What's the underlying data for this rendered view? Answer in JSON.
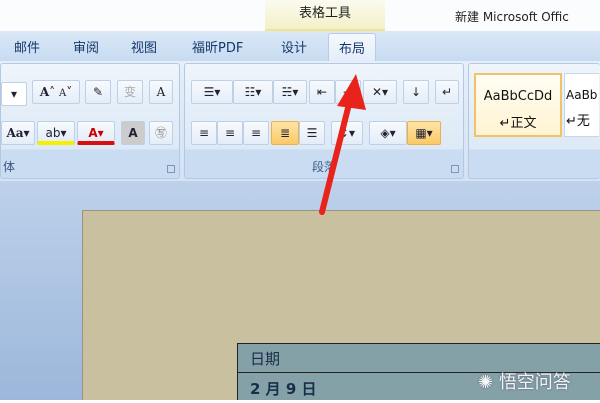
{
  "title_bar": {
    "contextual_group": "表格工具",
    "window_title": "新建 Microsoft Offic"
  },
  "tabs": [
    {
      "label": "邮件"
    },
    {
      "label": "审阅"
    },
    {
      "label": "视图"
    },
    {
      "label": "福昕PDF"
    },
    {
      "label": "设计"
    },
    {
      "label": "布局",
      "active": true
    }
  ],
  "ribbon": {
    "font_group": {
      "grow": "A",
      "shrink": "A",
      "change_case": "Aa",
      "font_color": "A",
      "char_shade": "A",
      "label": "体"
    },
    "paragraph_group": {
      "label": "段落"
    },
    "styles": [
      {
        "preview": "AaBbCcDd",
        "name": "↵正文",
        "selected": true
      },
      {
        "preview": "AaBb",
        "name": "↵无"
      }
    ]
  },
  "document": {
    "table": {
      "rows": [
        "日期",
        "2 月 9 日"
      ]
    }
  },
  "watermark": "悟空问答",
  "colors": {
    "arrow": "#e8231c",
    "page": "#c8c09e",
    "table_fill": "#84a1a8"
  }
}
